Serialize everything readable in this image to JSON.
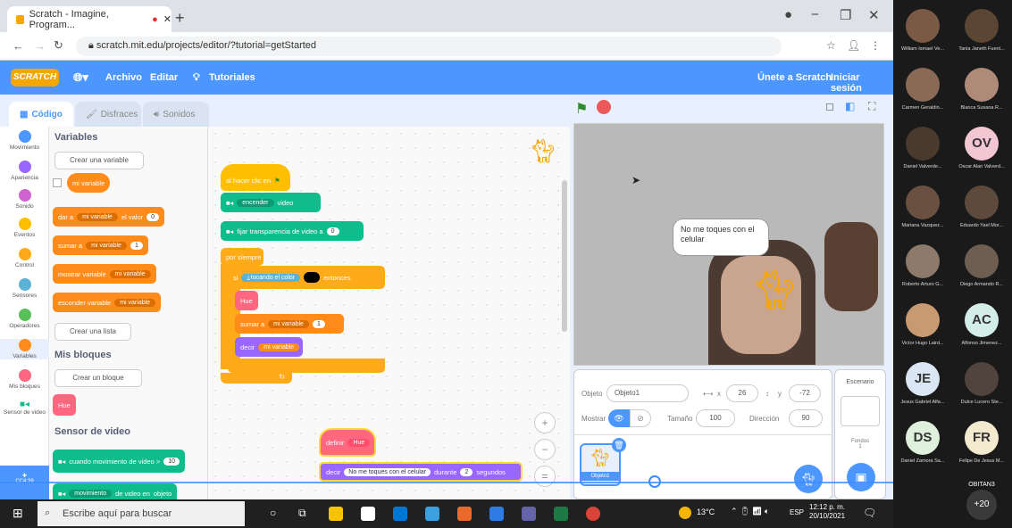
{
  "browser": {
    "tab_title": "Scratch - Imagine, Program...",
    "url": "scratch.mit.edu/projects/editor/?tutorial=getStarted"
  },
  "menubar": {
    "logo": "SCRATCH",
    "items": [
      "Archivo",
      "Editar",
      "Tutoriales"
    ],
    "join": "Únete a Scratch",
    "signin": "Iniciar sesión"
  },
  "editor_tabs": [
    "Código",
    "Disfraces",
    "Sonidos"
  ],
  "categories": [
    {
      "label": "Movimiento",
      "color": "#4c97ff"
    },
    {
      "label": "Apariencia",
      "color": "#9966ff"
    },
    {
      "label": "Sonido",
      "color": "#cf63cf"
    },
    {
      "label": "Eventos",
      "color": "#ffbf00"
    },
    {
      "label": "Control",
      "color": "#ffab19"
    },
    {
      "label": "Sensores",
      "color": "#5cb1d6"
    },
    {
      "label": "Operadores",
      "color": "#59c059"
    },
    {
      "label": "Variables",
      "color": "#ff8c1a"
    },
    {
      "label": "Mis bloques",
      "color": "#ff6680"
    },
    {
      "label": "Sensor de video",
      "color": "#0fbd8c"
    }
  ],
  "palette": {
    "variables_title": "Variables",
    "create_var": "Crear una variable",
    "my_var": "mi variable",
    "set_block": {
      "a": "dar a",
      "var": "mi variable",
      "b": "el valor",
      "val": "0"
    },
    "change_block": {
      "a": "sumar a",
      "var": "mi variable",
      "val": "1"
    },
    "show_block": {
      "a": "mostrar variable",
      "var": "mi variable"
    },
    "hide_block": {
      "a": "esconder variable",
      "var": "mi variable"
    },
    "create_list": "Crear una lista",
    "myblocks_title": "Mis bloques",
    "create_block": "Crear un bloque",
    "hue_block": "Hue",
    "video_title": "Sensor de video",
    "video_block": {
      "a": "cuando movimiento de video >",
      "val": "10"
    },
    "video_block2": {
      "a": "movimiento",
      "b": "de video en",
      "c": "objeto"
    }
  },
  "script": {
    "hat": "al hacer clic en",
    "video_on": {
      "a": "encender",
      "b": "video"
    },
    "transparency": {
      "a": "fijar transparencia de video a",
      "val": "0"
    },
    "forever": "por siempre",
    "if": "si",
    "touching": "¿tocando el color",
    "then": "entonces",
    "hue": "Hue",
    "change": {
      "a": "sumar a",
      "var": "mi variable",
      "val": "1"
    },
    "say": {
      "a": "decir",
      "var": "mi variable"
    }
  },
  "script2": {
    "head": {
      "a": "definir",
      "b": "Hue"
    },
    "say": {
      "a": "decir",
      "msg": "No me toques con el celular",
      "b": "durante",
      "val": "2",
      "c": "segundos"
    }
  },
  "stage": {
    "bubble": "No me toques con el celular"
  },
  "sprite_panel": {
    "sprite_label": "Objeto",
    "sprite_name": "Objeto1",
    "x_label": "x",
    "x_val": "26",
    "y_label": "y",
    "y_val": "-72",
    "show_label": "Mostrar",
    "size_label": "Tamaño",
    "size_val": "100",
    "dir_label": "Dirección",
    "dir_val": "90",
    "thumb_name": "Objeto1"
  },
  "stage_panel": {
    "title": "Escenario",
    "backdrops": "Fondos",
    "count": "1"
  },
  "taskbar": {
    "search": "Escribe aquí para buscar",
    "weather": "13°C",
    "lang": "ESP",
    "time": "12:12 p. m.",
    "date": "20/10/2021"
  },
  "participants": [
    {
      "name": "William Ismael Ve...",
      "initials": "",
      "color": "#7a5a44"
    },
    {
      "name": "Tania Janeth Fuent...",
      "initials": "",
      "color": "#5a4632"
    },
    {
      "name": "Carmen Geraldin...",
      "initials": "",
      "color": "#8a6a56"
    },
    {
      "name": "Blanca Susana R...",
      "initials": "",
      "color": "#b08a78"
    },
    {
      "name": "Daniel Valverde...",
      "initials": "",
      "color": "#4a3a2e"
    },
    {
      "name": "Oscar Alan Valverd...",
      "initials": "OV",
      "color": "#f3c6d4"
    },
    {
      "name": "Mariana Vazquez...",
      "initials": "",
      "color": "#6a5040"
    },
    {
      "name": "Eduardo Yael Mor...",
      "initials": "",
      "color": "#5e4a3c"
    },
    {
      "name": "Roberto Arturo G...",
      "initials": "",
      "color": "#8e7a6a"
    },
    {
      "name": "Diego Armando R...",
      "initials": "",
      "color": "#6e5e52"
    },
    {
      "name": "Victor Hugo Laird...",
      "initials": "",
      "color": "#c79a72"
    },
    {
      "name": "Alfonso Jimenez...",
      "initials": "AC",
      "color": "#d3ede8"
    },
    {
      "name": "Jesus Gabriel Alfa...",
      "initials": "JE",
      "color": "#dbe6f4"
    },
    {
      "name": "Dulce Lucero Ste...",
      "initials": "",
      "color": "#50443c"
    },
    {
      "name": "Daniel Zamora Sa...",
      "initials": "DS",
      "color": "#dff0dc"
    },
    {
      "name": "Felipe De Jesus M...",
      "initials": "FR",
      "color": "#f4ead0"
    }
  ],
  "more": {
    "label": "OBITAN3",
    "count": "+20"
  }
}
